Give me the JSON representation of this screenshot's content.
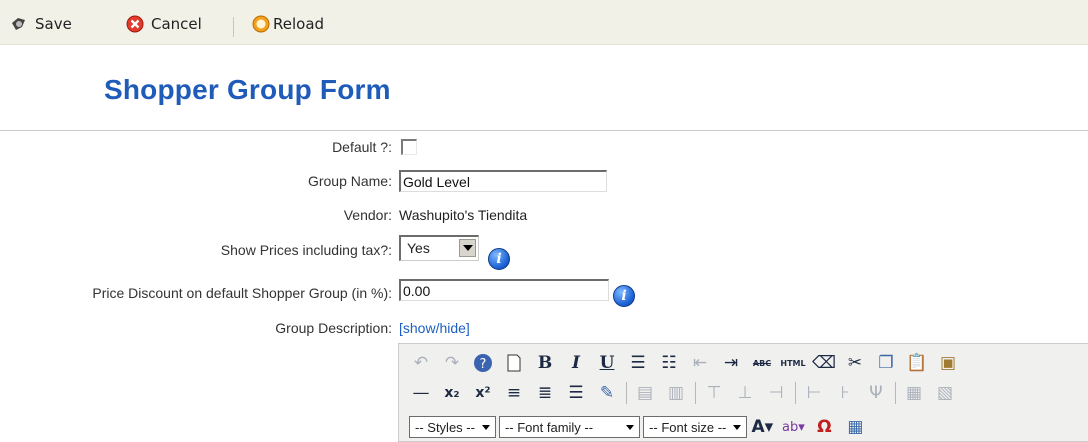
{
  "toolbar": {
    "save_label": "Save",
    "cancel_label": "Cancel",
    "reload_label": "Reload"
  },
  "page_title": "Shopper Group Form",
  "form": {
    "default_label": "Default ?:",
    "default_checked": false,
    "group_name_label": "Group Name:",
    "group_name_value": "Gold Level",
    "vendor_label": "Vendor:",
    "vendor_value": "Washupito's Tiendita",
    "show_prices_label": "Show Prices including tax?:",
    "show_prices_value": "Yes",
    "price_discount_label": "Price Discount on default Shopper Group (in %):",
    "price_discount_value": "0.00",
    "group_description_label": "Group Description:",
    "show_hide_link": "[show/hide]"
  },
  "editor": {
    "styles_dropdown": "-- Styles --",
    "font_family_dropdown": "-- Font family --",
    "font_size_dropdown": "-- Font size --",
    "bold_glyph": "B",
    "italic_glyph": "I",
    "underline_glyph": "U",
    "spellcheck_glyph": "ABC",
    "html_glyph": "HTML"
  },
  "colors": {
    "title": "#1f5bb8",
    "link": "#1d5fc2",
    "toolbar_bg": "#f2f1e8"
  }
}
